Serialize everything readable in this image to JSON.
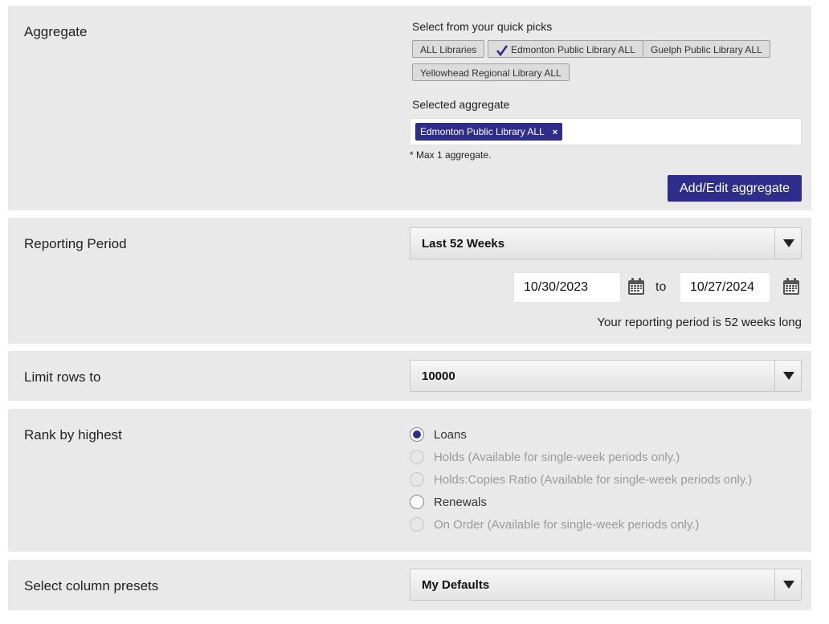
{
  "aggregate": {
    "label": "Aggregate",
    "quick_picks_label": "Select from your quick picks",
    "quick_picks": [
      "ALL Libraries",
      "Edmonton Public Library ALL",
      "Guelph Public Library ALL",
      "Yellowhead Regional Library ALL"
    ],
    "selected_quick_pick": "Edmonton Public Library ALL",
    "selected_label": "Selected aggregate",
    "selected_tag": "Edmonton Public Library ALL",
    "tag_remove": "×",
    "max_note": "* Max 1 aggregate.",
    "edit_button": "Add/Edit aggregate"
  },
  "reporting": {
    "label": "Reporting Period",
    "selected": "Last 52 Weeks",
    "start_date": "10/30/2023",
    "to_label": "to",
    "end_date": "10/27/2024",
    "summary": "Your reporting period is 52 weeks long"
  },
  "limit": {
    "label": "Limit rows to",
    "selected": "10000"
  },
  "rank": {
    "label": "Rank by highest",
    "options": [
      {
        "label": "Loans",
        "checked": true,
        "disabled": false
      },
      {
        "label": "Holds (Available for single-week periods only.)",
        "checked": false,
        "disabled": true
      },
      {
        "label": "Holds:Copies Ratio (Available for single-week periods only.)",
        "checked": false,
        "disabled": true
      },
      {
        "label": "Renewals",
        "checked": false,
        "disabled": false
      },
      {
        "label": "On Order (Available for single-week periods only.)",
        "checked": false,
        "disabled": true
      }
    ]
  },
  "presets": {
    "label": "Select column presets",
    "selected": "My Defaults"
  },
  "colors": {
    "accent": "#2e2e8a",
    "panel": "#e9e9e9"
  }
}
